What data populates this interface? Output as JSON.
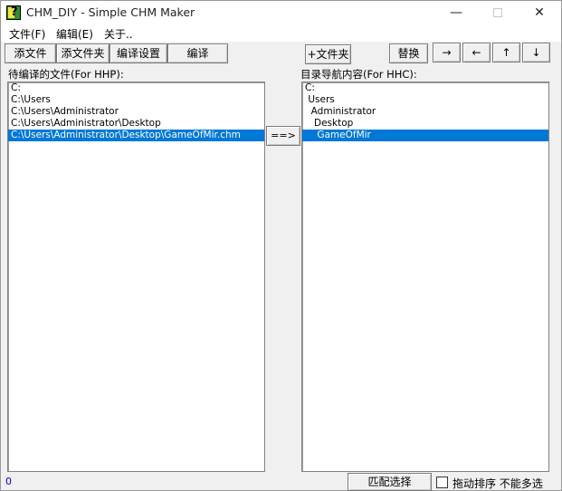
{
  "window": {
    "title": "CHM_DIY - Simple CHM Maker",
    "min_glyph": "—",
    "close_glyph": "✕"
  },
  "menu": [
    {
      "label": "文件(F)"
    },
    {
      "label": "编辑(E)"
    },
    {
      "label": "关于.."
    }
  ],
  "toolbar": {
    "add_file": "添文件",
    "add_folder": "添文件夹",
    "compile_settings": "编译设置",
    "compile": "编译",
    "plus_folder": "+文件夹",
    "replace": "替换",
    "move_right": "→",
    "move_left": "←",
    "move_up": "↑",
    "move_down": "↓"
  },
  "left_panel": {
    "label": "待编译的文件(For HHP):",
    "items": [
      {
        "text": "C:",
        "selected": false
      },
      {
        "text": "C:\\Users",
        "selected": false
      },
      {
        "text": "C:\\Users\\Administrator",
        "selected": false
      },
      {
        "text": "C:\\Users\\Administrator\\Desktop",
        "selected": false
      },
      {
        "text": "C:\\Users\\Administrator\\Desktop\\GameOfMir.chm",
        "selected": true
      }
    ]
  },
  "transfer_button": "==>",
  "right_panel": {
    "label": "目录导航内容(For HHC):",
    "items": [
      {
        "text": "C:",
        "selected": false
      },
      {
        "text": " Users",
        "selected": false
      },
      {
        "text": "  Administrator",
        "selected": false
      },
      {
        "text": "   Desktop",
        "selected": false
      },
      {
        "text": "    GameOfMir",
        "selected": true
      }
    ]
  },
  "status": {
    "count": "0",
    "match_select": "匹配选择",
    "drag_sort_label": "拖动排序 不能多选",
    "drag_sort_checked": false
  },
  "colors": {
    "selection": "#0078d7",
    "count_text": "#0000cc"
  }
}
